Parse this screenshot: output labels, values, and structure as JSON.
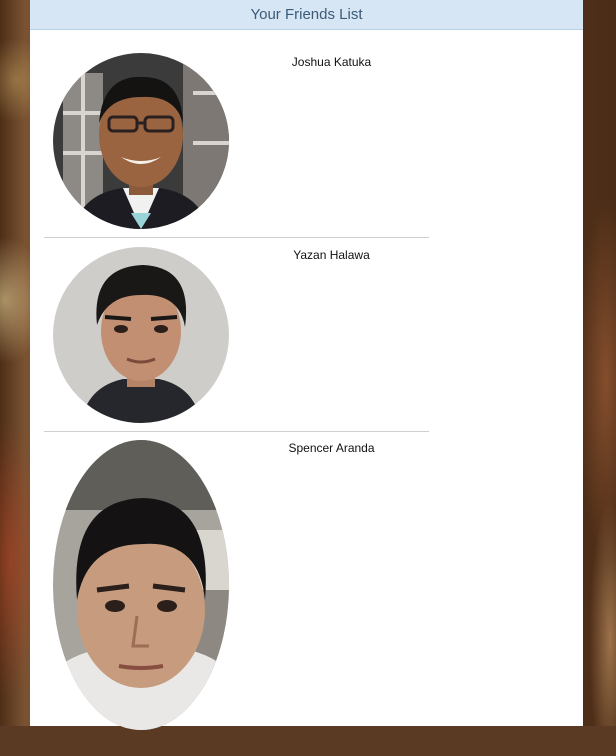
{
  "panel": {
    "title": "Your Friends List"
  },
  "friends": [
    {
      "name": "Joshua Katuka",
      "avatar_icon": "profile-photo"
    },
    {
      "name": "Yazan Halawa",
      "avatar_icon": "profile-photo"
    },
    {
      "name": "Spencer Aranda",
      "avatar_icon": "profile-photo"
    }
  ],
  "colors": {
    "header_bg": "#d6e6f4",
    "header_text": "#3b5b78",
    "divider": "#cfcfcf"
  }
}
